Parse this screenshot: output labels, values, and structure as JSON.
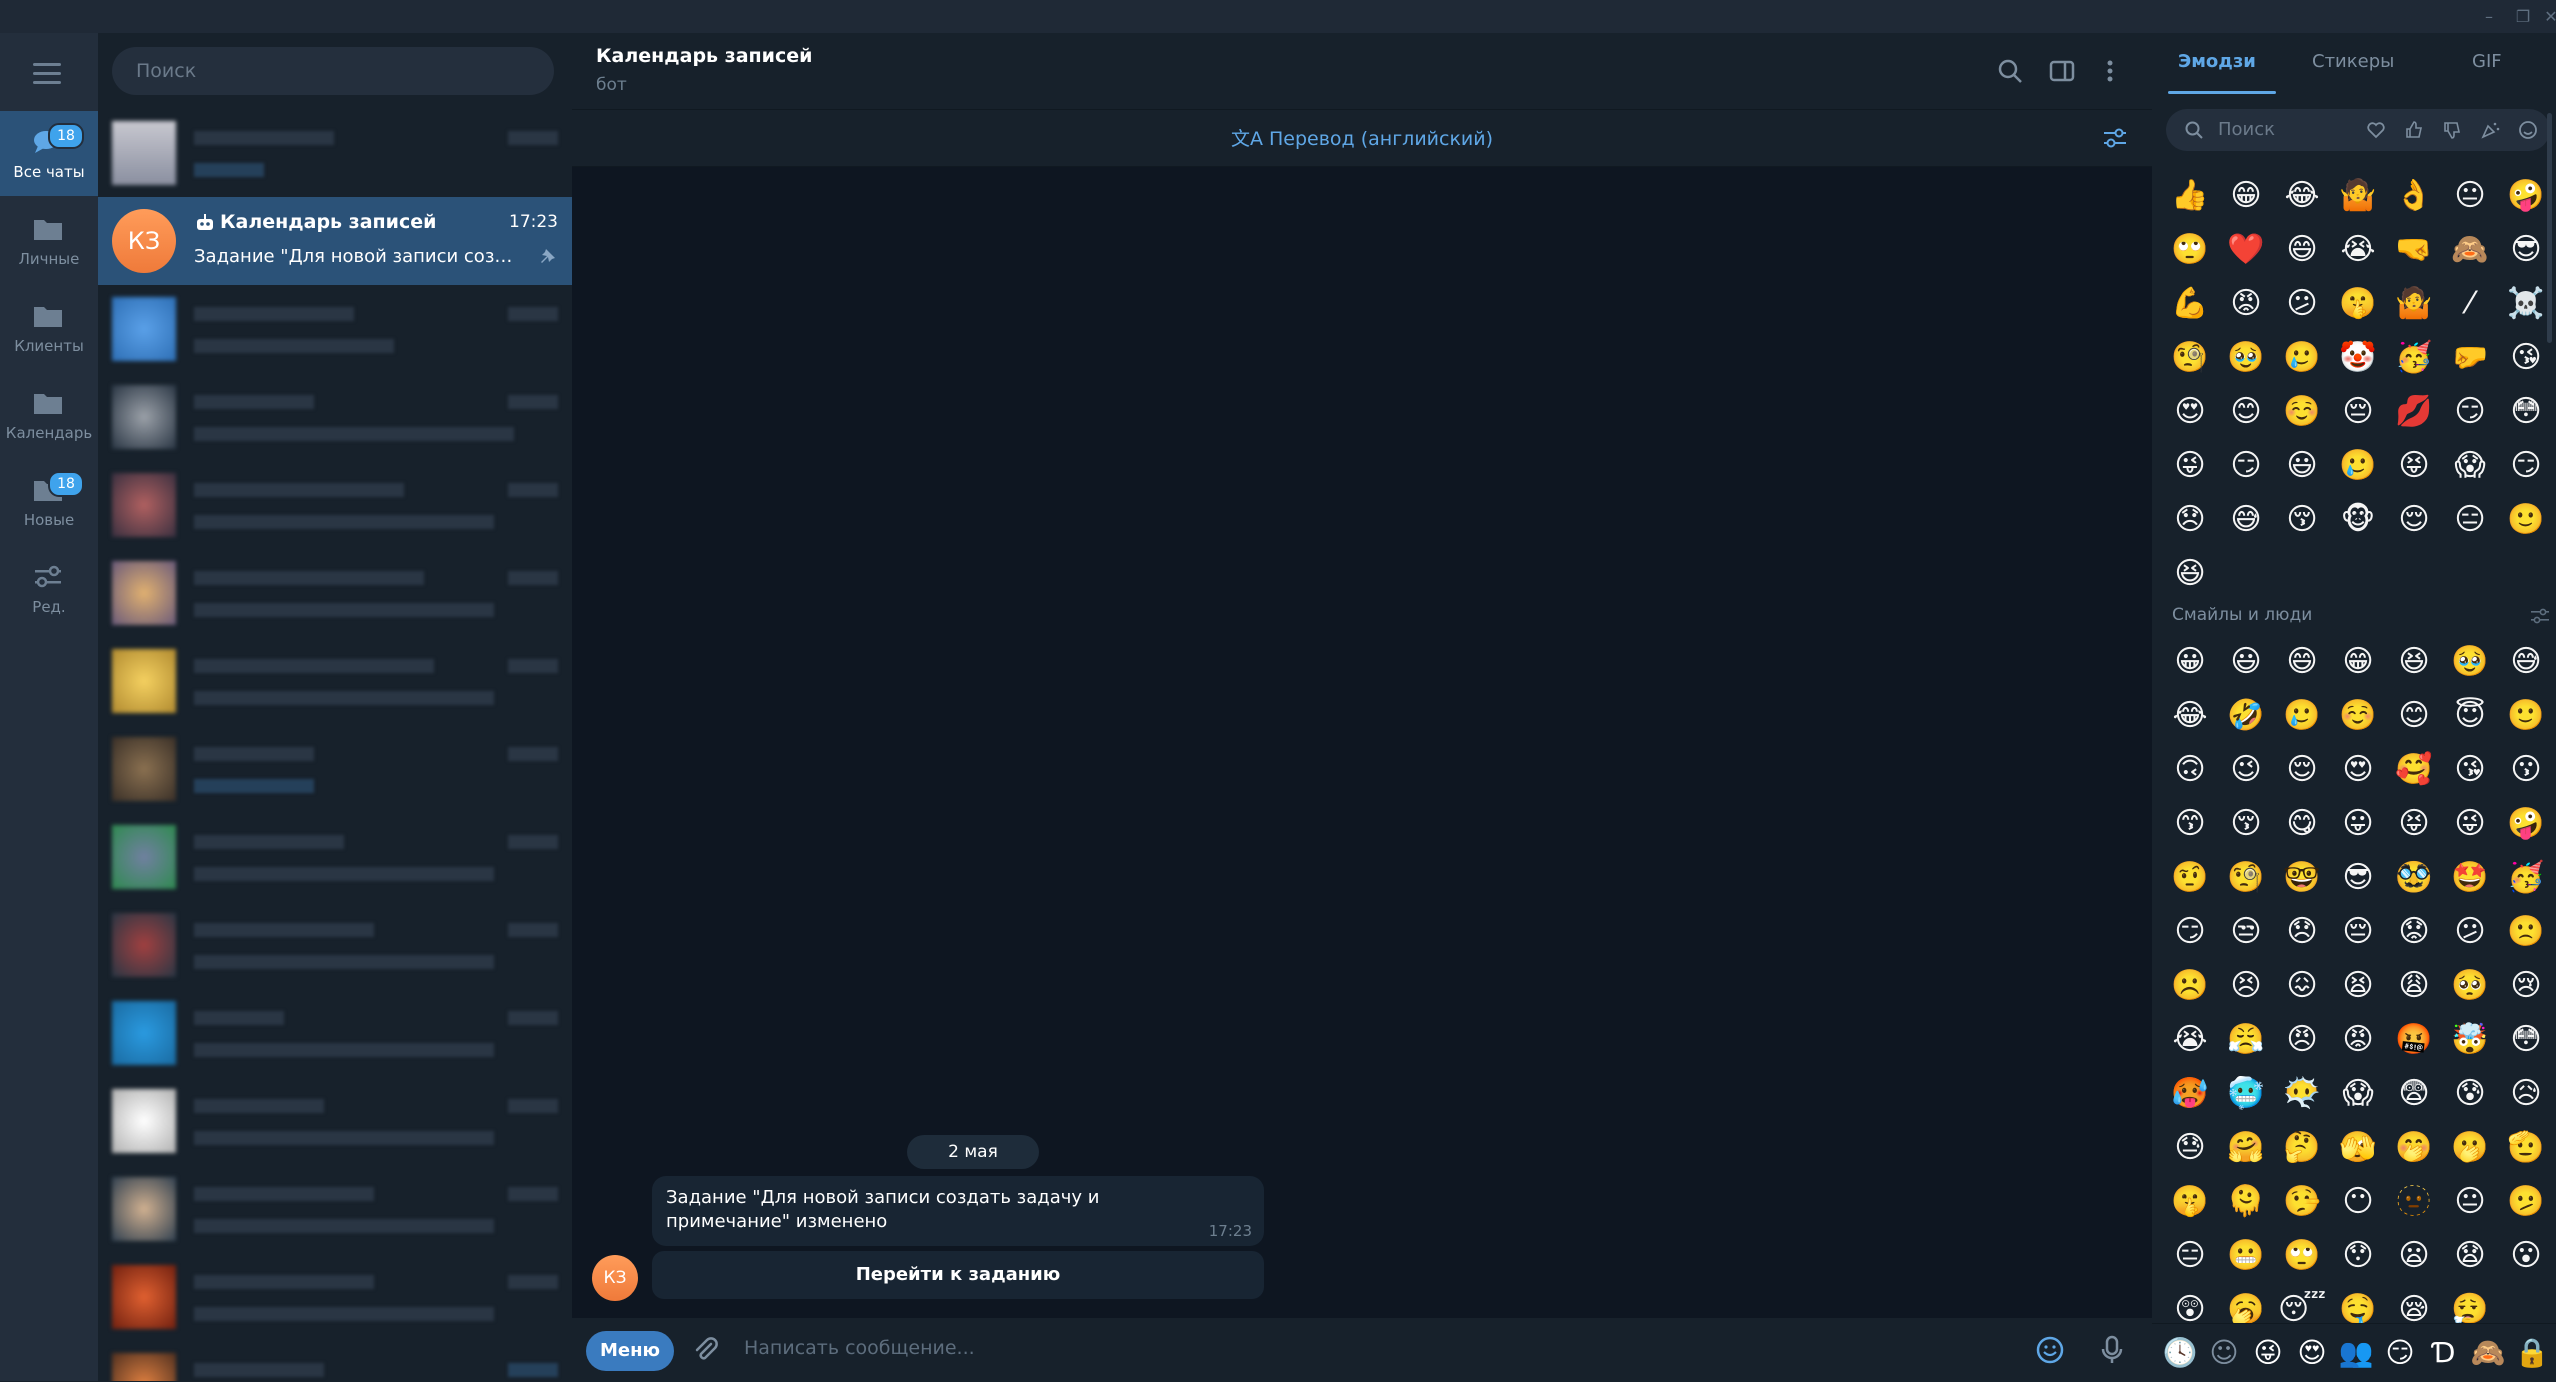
{
  "window": {
    "minimize": "–",
    "restore": "❐",
    "close": "✕"
  },
  "folders": [
    {
      "label": "Все чаты",
      "badge": "18",
      "active": true
    },
    {
      "label": "Личные"
    },
    {
      "label": "Клиенты"
    },
    {
      "label": "Календарь"
    },
    {
      "label": "Новые",
      "badge": "18"
    },
    {
      "label": "Ред."
    }
  ],
  "chatlist": {
    "search_placeholder": "Поиск",
    "active_chat": {
      "avatar": "КЗ",
      "title": "Календарь записей",
      "time": "17:23",
      "preview": "Задание \"Для новой записи создать задачу и примечание\" изменено"
    }
  },
  "chat": {
    "title": "Календарь записей",
    "subtitle": "бот",
    "translate": "Перевод (английский)",
    "date": "2 мая",
    "message_text": "Задание \"Для новой записи создать задачу и примечание\" изменено",
    "message_time": "17:23",
    "inline_button": "Перейти к заданию",
    "avatar": "КЗ",
    "menu_button": "Меню",
    "composer_placeholder": "Написать сообщение..."
  },
  "emoji_panel": {
    "tabs": [
      "Эмодзи",
      "Стикеры",
      "GIF"
    ],
    "search_placeholder": "Поиск",
    "section_title": "Смайлы и люди",
    "recent": [
      "👍",
      "😁",
      "😂",
      "🤷",
      "👌",
      "😐",
      "🤪",
      "🙄",
      "❤️",
      "😄",
      "😭",
      "🤜",
      "🙈",
      "😎",
      "💪",
      "😡",
      "😕",
      "🤫",
      "🤷",
      "⁄",
      "☠️",
      "🧐",
      "🥹",
      "🥲",
      "🤡",
      "🥳",
      "🤛",
      "😘",
      "😍",
      "😊",
      "☺️",
      "😔",
      "💋",
      "😏",
      "😳",
      "😜",
      "😏",
      "😃",
      "🥲",
      "😝",
      "😱",
      "😏",
      "😞",
      "😅",
      "😚",
      "🐵",
      "😌",
      "😑",
      "🙂",
      "😆"
    ],
    "people": [
      "😀",
      "😃",
      "😄",
      "😁",
      "😆",
      "🥹",
      "😅",
      "😂",
      "🤣",
      "🥲",
      "☺️",
      "😊",
      "😇",
      "🙂",
      "🙃",
      "😉",
      "😌",
      "😍",
      "🥰",
      "😘",
      "😗",
      "😙",
      "😚",
      "😋",
      "😛",
      "😝",
      "😜",
      "🤪",
      "🤨",
      "🧐",
      "🤓",
      "😎",
      "🥸",
      "🤩",
      "🥳",
      "😏",
      "😒",
      "😞",
      "😔",
      "😟",
      "😕",
      "🙁",
      "☹️",
      "😣",
      "😖",
      "😫",
      "😩",
      "🥺",
      "😢",
      "😭",
      "😤",
      "😠",
      "😡",
      "🤬",
      "🤯",
      "😳",
      "🥵",
      "🥶",
      "😶‍🌫️",
      "😱",
      "😨",
      "😰",
      "😥",
      "😓",
      "🤗",
      "🤔",
      "🫣",
      "🤭",
      "🫢",
      "🫡",
      "🤫",
      "🫠",
      "🤥",
      "😶",
      "🫥",
      "😐",
      "🫤",
      "😑",
      "😬",
      "🙄",
      "😯",
      "😦",
      "😧",
      "😮",
      "😲",
      "🥱",
      "😴",
      "🤤",
      "😪",
      "😮‍💨"
    ],
    "bottom_tabs": [
      "🕓",
      "☺",
      "😜",
      "😍",
      "👥",
      "😏",
      "Ɗ",
      "🙈",
      "🔒"
    ]
  }
}
